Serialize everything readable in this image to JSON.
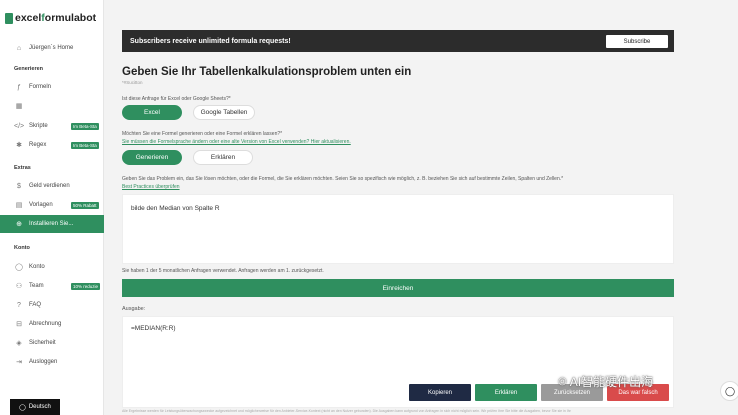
{
  "brand": {
    "logo_part1": "excel",
    "logo_part2": "f",
    "logo_part3": "ormulabot"
  },
  "sidebar": {
    "user": "Jüergen´s Home",
    "section_generate": "Generieren",
    "formulas": "Formeln",
    "scripts": "Skripte",
    "scripts_badge": "Im Beta-Sta",
    "regex": "Regex",
    "regex_badge": "Im Beta-Sta",
    "section_extras": "Extras",
    "earn": "Geld verdienen",
    "templates": "Vorlagen",
    "templates_badge": "50% Rabatt",
    "install": "Installieren Sie...",
    "section_account": "Konto",
    "account": "Konto",
    "team": "Team",
    "team_badge": "10% reduzie",
    "faq": "FAQ",
    "billing": "Abrechnung",
    "security": "Sicherheit",
    "logout": "Ausloggen",
    "language": "Deutsch"
  },
  "banner": {
    "text": "Subscribers receive unlimited formula requests!",
    "subscribe": "Subscribe"
  },
  "form": {
    "title": "Geben Sie Ihr Tabellenkalkulationsproblem unten ein",
    "hint": "*#Sucitton",
    "q_platform": "Ist diese Anfrage für Excel oder Google Sheets?*",
    "opt_excel": "Excel",
    "opt_google": "Google Tabellen",
    "q_mode": "Möchten Sie eine Formel generieren oder eine Formel erklären lassen?*",
    "q_mode_link": "Sie müssen die Formelsprache ändern oder eine alte Version von Excel verwenden? Hier aktualisieren.",
    "opt_generate": "Generieren",
    "opt_explain": "Erklären",
    "q_problem": "Geben Sie das Problem ein, das Sie lösen möchten, oder die Formel, die Sie erklären möchten. Seien Sie so spezifisch wie möglich, z. B. beziehen Sie sich auf bestimmte Zeilen, Spalten und Zellen.*",
    "best_practices": "Best Practices überprüfen",
    "input_value": "bilde den Median von Spalte R",
    "usage": "Sie haben 1 der 5 monatlichen Anfragen verwendet. Anfragen werden am 1. zurückgesetzt.",
    "submit": "Einreichen",
    "output_label": "Ausgabe:",
    "output_value": "=MEDIAN(R:R)",
    "btn_copy": "Kopieren",
    "btn_explain": "Erklären",
    "btn_back": "Zurücksetzen",
    "btn_wrong": "Das war falsch",
    "footer": "Alle Ergebnisse werden für Leistungsüberwachungszwecke aufgezeichnet und möglicherweise für den Anbieter-Service-Kontext (nicht an den Nutzer gebunden). Die Ausgaben kann aufgrund von Anfragen in sich nicht möglich sein. Wir prüfen Ihre Sie bitte die Ausgaben, bevor Sie sie in Ihr"
  },
  "watermark": {
    "text": "AI智能硬件出海"
  },
  "colors": {
    "accent": "#2f8f5f",
    "dark": "#2c2c2c",
    "copy": "#1f2a44",
    "wrong": "#d94b4b"
  }
}
